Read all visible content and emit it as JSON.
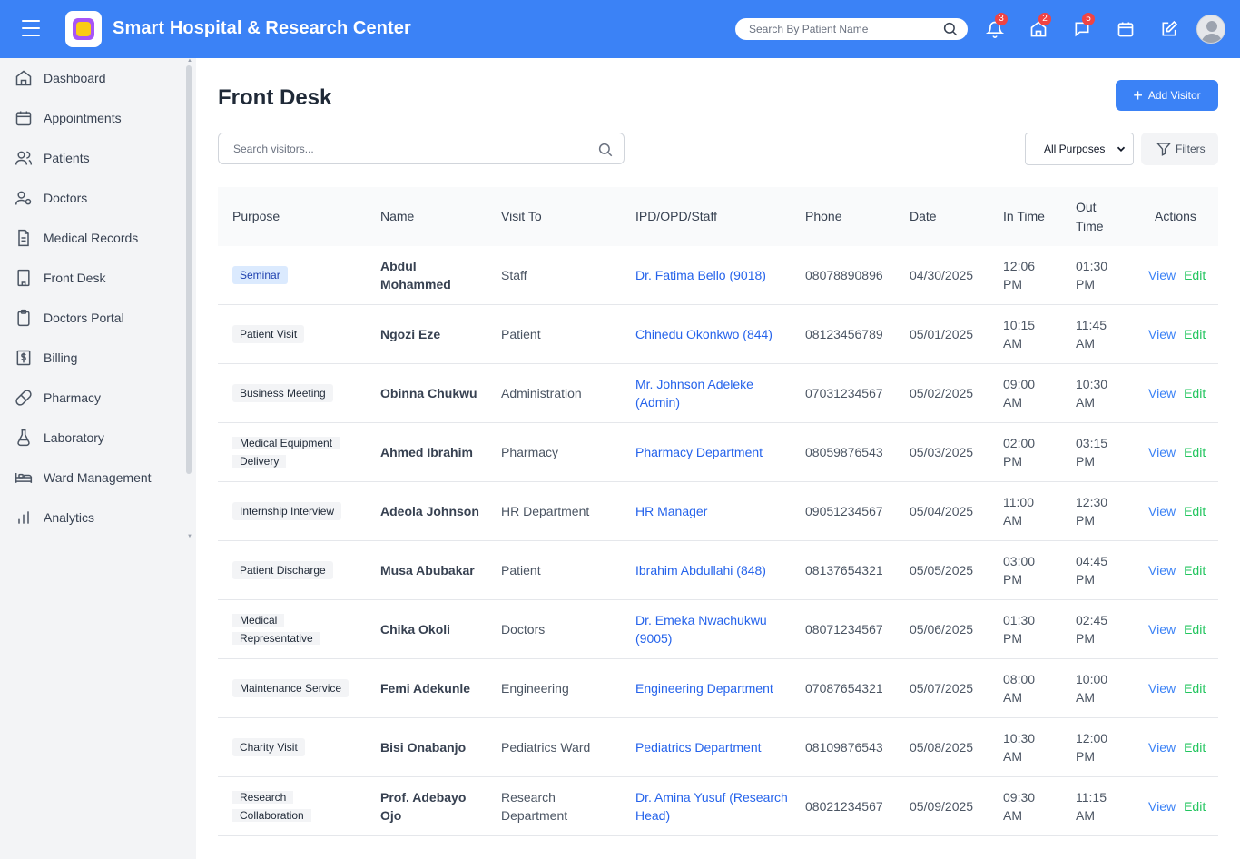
{
  "header": {
    "title": "Smart Hospital & Research Center",
    "search_placeholder": "Search By Patient Name",
    "badges": {
      "notifications": "3",
      "home": "2",
      "messages": "5"
    }
  },
  "sidebar": {
    "items": [
      {
        "label": "Dashboard",
        "icon": "home-icon"
      },
      {
        "label": "Appointments",
        "icon": "calendar-icon"
      },
      {
        "label": "Patients",
        "icon": "users-icon"
      },
      {
        "label": "Doctors",
        "icon": "user-cog-icon"
      },
      {
        "label": "Medical Records",
        "icon": "file-text-icon"
      },
      {
        "label": "Front Desk",
        "icon": "building-icon"
      },
      {
        "label": "Doctors Portal",
        "icon": "clipboard-icon"
      },
      {
        "label": "Billing",
        "icon": "dollar-icon"
      },
      {
        "label": "Pharmacy",
        "icon": "pill-icon"
      },
      {
        "label": "Laboratory",
        "icon": "flask-icon"
      },
      {
        "label": "Ward Management",
        "icon": "bed-icon"
      },
      {
        "label": "Analytics",
        "icon": "bar-chart-icon"
      }
    ]
  },
  "main": {
    "title": "Front Desk",
    "add_button": "Add Visitor",
    "search_placeholder": "Search visitors...",
    "purpose_filter": "All Purposes",
    "filters_button": "Filters",
    "columns": {
      "purpose": "Purpose",
      "name": "Name",
      "visit_to": "Visit To",
      "staff": "IPD/OPD/Staff",
      "phone": "Phone",
      "date": "Date",
      "in_time": "In Time",
      "out_time": "Out Time",
      "actions": "Actions"
    },
    "action_view": "View",
    "action_edit": "Edit",
    "rows": [
      {
        "purpose": "Seminar",
        "name": "Abdul Mohammed",
        "visit_to": "Staff",
        "staff": "Dr. Fatima Bello (9018)",
        "phone": "08078890896",
        "date": "04/30/2025",
        "in_time": "12:06 PM",
        "out_time": "01:30 PM"
      },
      {
        "purpose": "Patient Visit",
        "name": "Ngozi Eze",
        "visit_to": "Patient",
        "staff": "Chinedu Okonkwo (844)",
        "phone": "08123456789",
        "date": "05/01/2025",
        "in_time": "10:15 AM",
        "out_time": "11:45 AM"
      },
      {
        "purpose": "Business Meeting",
        "name": "Obinna Chukwu",
        "visit_to": "Administration",
        "staff": "Mr. Johnson Adeleke (Admin)",
        "phone": "07031234567",
        "date": "05/02/2025",
        "in_time": "09:00 AM",
        "out_time": "10:30 AM"
      },
      {
        "purpose": "Medical Equipment Delivery",
        "name": "Ahmed Ibrahim",
        "visit_to": "Pharmacy",
        "staff": "Pharmacy Department",
        "phone": "08059876543",
        "date": "05/03/2025",
        "in_time": "02:00 PM",
        "out_time": "03:15 PM"
      },
      {
        "purpose": "Internship Interview",
        "name": "Adeola Johnson",
        "visit_to": "HR Department",
        "staff": "HR Manager",
        "phone": "09051234567",
        "date": "05/04/2025",
        "in_time": "11:00 AM",
        "out_time": "12:30 PM"
      },
      {
        "purpose": "Patient Discharge",
        "name": "Musa Abubakar",
        "visit_to": "Patient",
        "staff": "Ibrahim Abdullahi (848)",
        "phone": "08137654321",
        "date": "05/05/2025",
        "in_time": "03:00 PM",
        "out_time": "04:45 PM"
      },
      {
        "purpose": "Medical Representative",
        "name": "Chika Okoli",
        "visit_to": "Doctors",
        "staff": "Dr. Emeka Nwachukwu (9005)",
        "phone": "08071234567",
        "date": "05/06/2025",
        "in_time": "01:30 PM",
        "out_time": "02:45 PM"
      },
      {
        "purpose": "Maintenance Service",
        "name": "Femi Adekunle",
        "visit_to": "Engineering",
        "staff": "Engineering Department",
        "phone": "07087654321",
        "date": "05/07/2025",
        "in_time": "08:00 AM",
        "out_time": "10:00 AM"
      },
      {
        "purpose": "Charity Visit",
        "name": "Bisi Onabanjo",
        "visit_to": "Pediatrics Ward",
        "staff": "Pediatrics Department",
        "phone": "08109876543",
        "date": "05/08/2025",
        "in_time": "10:30 AM",
        "out_time": "12:00 PM"
      },
      {
        "purpose": "Research Collaboration",
        "name": "Prof. Adebayo Ojo",
        "visit_to": "Research Department",
        "staff": "Dr. Amina Yusuf (Research Head)",
        "phone": "08021234567",
        "date": "05/09/2025",
        "in_time": "09:30 AM",
        "out_time": "11:15 AM"
      }
    ]
  }
}
